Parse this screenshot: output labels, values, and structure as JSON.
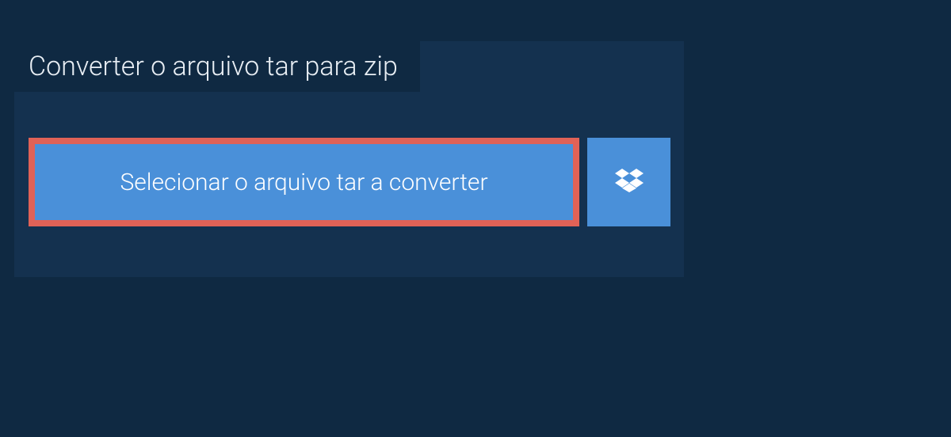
{
  "header": {
    "title": "Converter o arquivo tar para zip"
  },
  "actions": {
    "select_file_label": "Selecionar o arquivo tar a converter",
    "dropbox_icon_name": "dropbox-icon"
  }
}
